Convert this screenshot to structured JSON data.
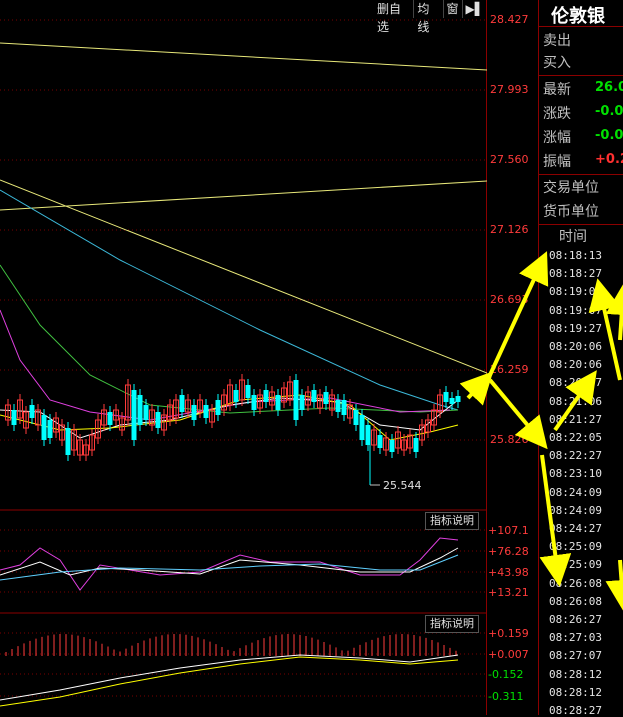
{
  "toolbar": {
    "delete_label": "删自选",
    "ma_label": "均线",
    "window_label": "窗",
    "expand_icon": "expand-icon"
  },
  "price_axis": [
    "28.427",
    "27.993",
    "27.560",
    "27.126",
    "26.693",
    "26.259",
    "25.826"
  ],
  "low_marker": "25.544",
  "indicator1": {
    "button": "指标说明",
    "ticks": [
      "+107.1",
      "+76.28",
      "+43.98",
      "+13.21"
    ]
  },
  "indicator2": {
    "button": "指标说明",
    "ticks": [
      "+0.159",
      "+0.007",
      "-0.152",
      "-0.311"
    ]
  },
  "quote": {
    "title": "伦敦银",
    "sell_label": "卖出",
    "buy_label": "买入",
    "latest_label": "最新",
    "latest_value": "26.0",
    "change_label": "涨跌",
    "change_value": "-0.0",
    "change_pct_label": "涨幅",
    "change_pct_value": "-0.0",
    "amplitude_label": "振幅",
    "amplitude_value": "+0.2",
    "trade_unit_label": "交易单位",
    "currency_label": "货币单位",
    "time_header": "时间",
    "times": [
      "08:18:13",
      "08:18:27",
      "08:19:07",
      "08:19:07",
      "08:19:27",
      "08:20:06",
      "08:20:06",
      "08:20:27",
      "08:21:06",
      "08:21:27",
      "08:22:05",
      "08:22:27",
      "08:23:10",
      "08:24:09",
      "08:24:09",
      "08:24:27",
      "08:25:09",
      "08:25:09",
      "08:26:08",
      "08:26:08",
      "08:26:27",
      "08:27:03",
      "08:27:07",
      "08:28:12",
      "08:28:12",
      "08:28:27"
    ]
  },
  "colors": {
    "up": "#ff3b3b",
    "down": "#00ffff",
    "yellow": "#ffff00",
    "green_value": "#00e000",
    "red_value": "#ff3030",
    "grid": "#7a0000"
  }
}
